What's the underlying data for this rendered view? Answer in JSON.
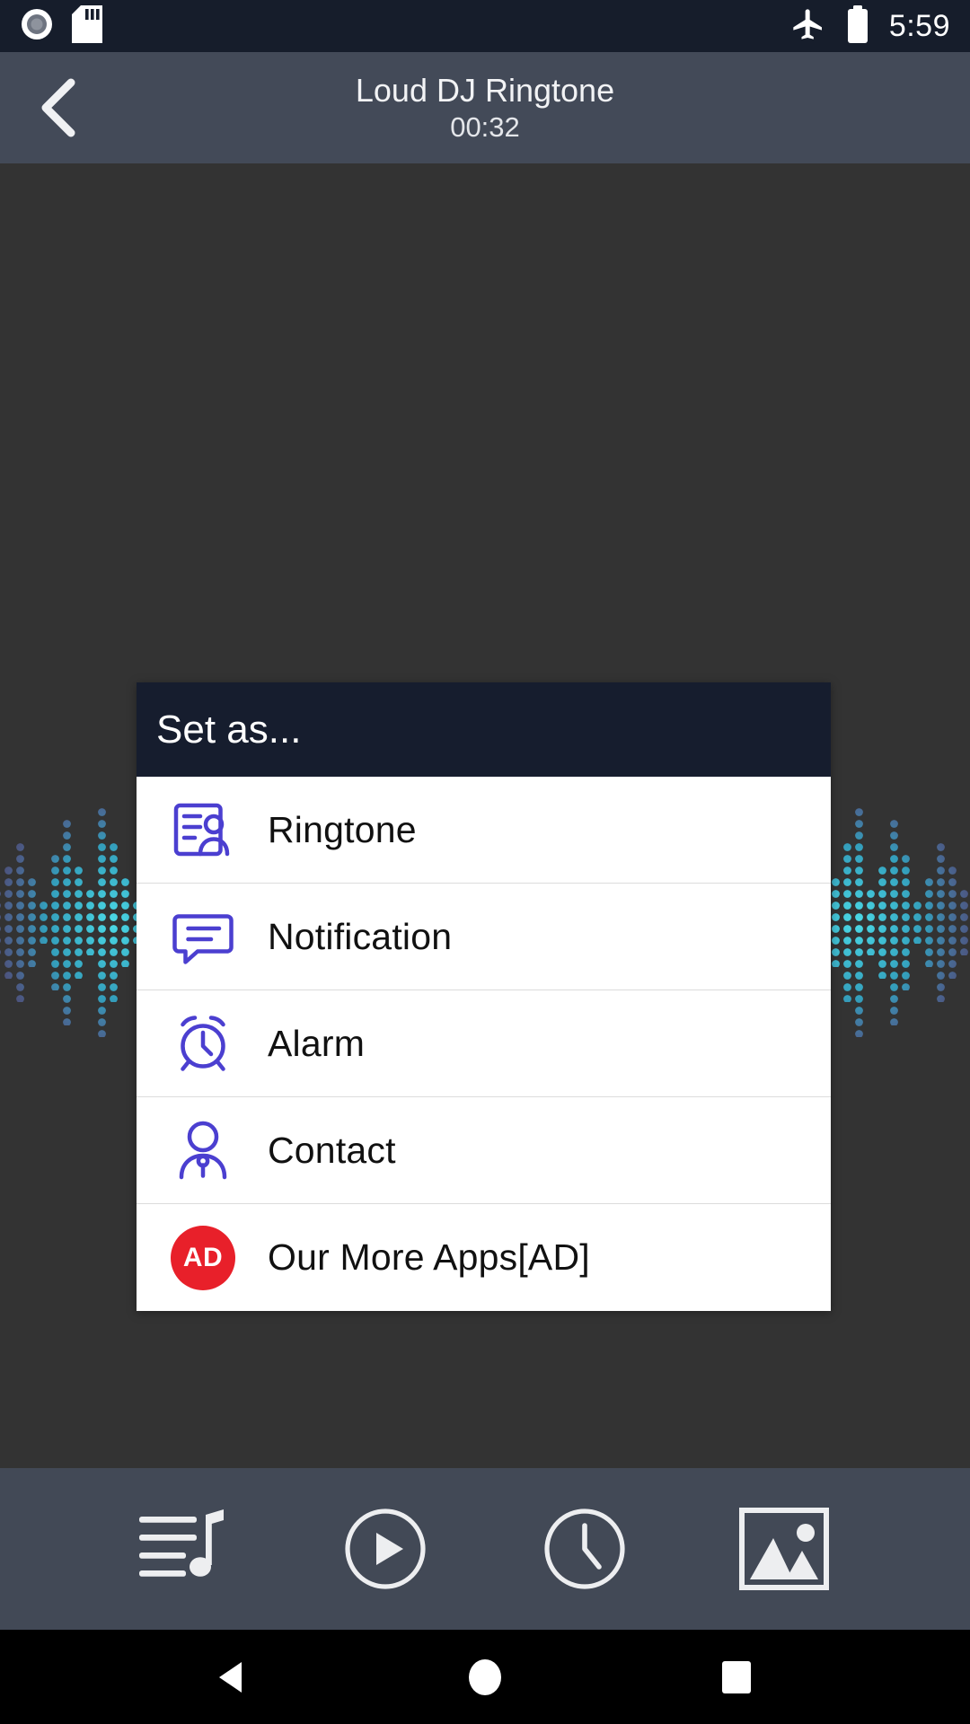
{
  "status_bar": {
    "icons_left": [
      "screen-record-icon",
      "sd-card-icon"
    ],
    "icons_right": [
      "airplane-mode-icon",
      "battery-icon"
    ],
    "time": "5:59",
    "background_color": "#161D2B"
  },
  "header": {
    "back_icon": "back-chevron-icon",
    "title": "Loud DJ Ringtone",
    "duration": "00:32",
    "background_color": "#434A58"
  },
  "content": {
    "background_color": "#333333",
    "waveform_icon": "audio-waveform-visualizer",
    "waveform_colors": [
      "#2FC8E0",
      "#3FA9D8",
      "#6E7FE0",
      "#4DD9E8"
    ]
  },
  "dialog": {
    "title": "Set as...",
    "header_color": "#161D2E",
    "background_color": "#FFFFFF",
    "items": [
      {
        "label": "Ringtone",
        "icon": "contact-card-icon",
        "icon_color": "#4B3FD0"
      },
      {
        "label": "Notification",
        "icon": "message-bubble-icon",
        "icon_color": "#4B3FD0"
      },
      {
        "label": "Alarm",
        "icon": "alarm-clock-icon",
        "icon_color": "#4B3FD0"
      },
      {
        "label": "Contact",
        "icon": "person-icon",
        "icon_color": "#4B3FD0"
      },
      {
        "label": "Our More Apps[AD]",
        "icon": "ad-badge-icon",
        "icon_color": "#E8202A",
        "badge_text": "AD"
      }
    ]
  },
  "toolbar": {
    "background_color": "#424956",
    "buttons": [
      {
        "name": "playlist-music-icon"
      },
      {
        "name": "play-circle-icon"
      },
      {
        "name": "clock-icon"
      },
      {
        "name": "gallery-image-icon"
      }
    ]
  },
  "navbar": {
    "background_color": "#000000",
    "buttons": [
      {
        "name": "android-back-icon"
      },
      {
        "name": "android-home-icon"
      },
      {
        "name": "android-recents-icon"
      }
    ]
  }
}
